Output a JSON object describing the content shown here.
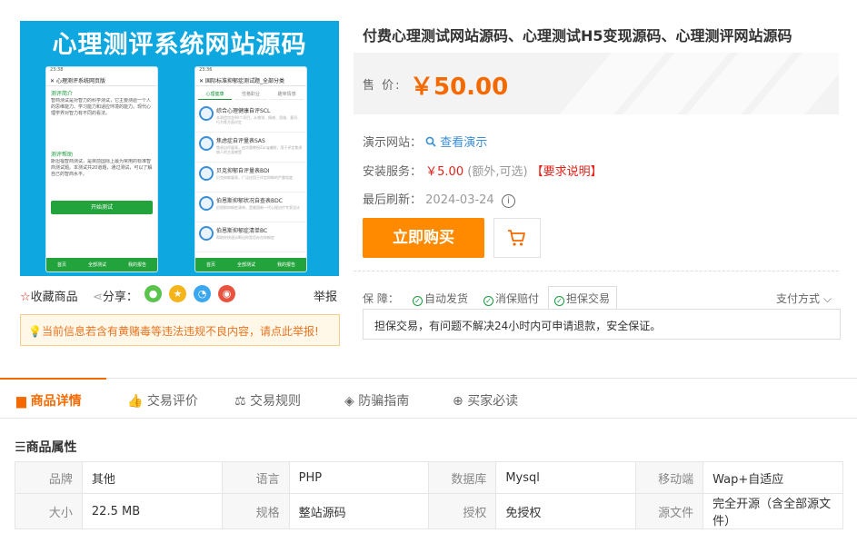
{
  "banner": {
    "title": "心理测评系统网站源码",
    "phone1": {
      "status": "23:38",
      "title": "心理测评系统网页版",
      "section1_title": "测评简介",
      "section1_body": "智商测试是对智力的科学测试，它主要测验一个人的思维能力、学习能力和适应环境的能力。现代心理学界对智力有不同的看法。",
      "section2_title": "测评帮助",
      "section2_body": "斯坦福智商测试，是目前国际上最为常用的标准智商测试题。本测试共20道题，通过测试，可以了解自己的智商水平。",
      "start_label": "开始测试",
      "nav": [
        "首页",
        "全部测试",
        "我的报告"
      ]
    },
    "phone2": {
      "status": "23:36",
      "title": "国际标准抑郁症测试题_全部分类",
      "tabs": [
        "心理健康",
        "性格职业",
        "趣味情感"
      ],
      "items": [
        {
          "name": "综合心理健康自评SCL",
          "desc": "本测验包含90个项目，从感觉、情感、思维、意识、行为等方面评定"
        },
        {
          "name": "焦虑症自评量表SAS",
          "desc": "焦虑自评量表，由华裔教授Zung编制，用于评定焦虑病人的主观感受"
        },
        {
          "name": "贝克抑郁自评量表BDI",
          "desc": "贝克抑郁量表，广泛应用于评定抑郁的严重程度"
        },
        {
          "name": "伯恩斯抑郁状况自查表BDC",
          "desc": "伯恩斯抑郁症清单，是美国新一代心理治疗专家设计"
        },
        {
          "name": "伯恩斯抑郁症清单BC",
          "desc": "帮助你快速诊断出你是否存在抑郁症"
        }
      ],
      "nav": [
        "首页",
        "全部测试",
        "我的报告"
      ]
    }
  },
  "product": {
    "title": "付费心理测试网站源码、心理测试H5变现源码、心理测评网站源码",
    "price_label": "售 价:",
    "price": "￥50.00"
  },
  "info": {
    "demo_label": "演示网站：",
    "demo_link": "查看演示",
    "install_label": "安装服务：",
    "install_price": "￥5.00",
    "install_note": "(额外,可选)",
    "install_req": "【要求说明】",
    "refresh_label": "最后刷新：",
    "refresh_date": "2024-03-24",
    "info_icon": "i"
  },
  "actions": {
    "buy": "立即购买",
    "cart_icon": "cart-icon"
  },
  "guarantee": {
    "label": "保 障：",
    "items": [
      "自动发货",
      "消保赔付",
      "担保交易"
    ],
    "payment": "支付方式",
    "desc": "担保交易，有问题不解决24小时内可申请退款，安全保证。"
  },
  "left": {
    "favorite": "收藏商品",
    "share": "分享：",
    "report": "举报",
    "notice": "当前信息若含有黄赌毒等违法违规不良内容，请点此举报!"
  },
  "tabs": [
    "商品详情",
    "交易评价",
    "交易规则",
    "防骗指南",
    "买家必读"
  ],
  "attributes": {
    "title": "商品属性",
    "rows": [
      [
        [
          "品牌",
          "其他"
        ],
        [
          "语言",
          "PHP"
        ],
        [
          "数据库",
          "Mysql"
        ],
        [
          "移动端",
          "Wap+自适应"
        ]
      ],
      [
        [
          "大小",
          "22.5 MB"
        ],
        [
          "规格",
          "整站源码"
        ],
        [
          "授权",
          "免授权"
        ],
        [
          "源文件",
          "完全开源（含全部源文件）"
        ]
      ]
    ]
  },
  "colors": {
    "accent": "#f56a00",
    "buy": "#ff8a00",
    "link": "#3b8fd8",
    "banner": "#0fa7e0",
    "green": "#22a33b"
  }
}
